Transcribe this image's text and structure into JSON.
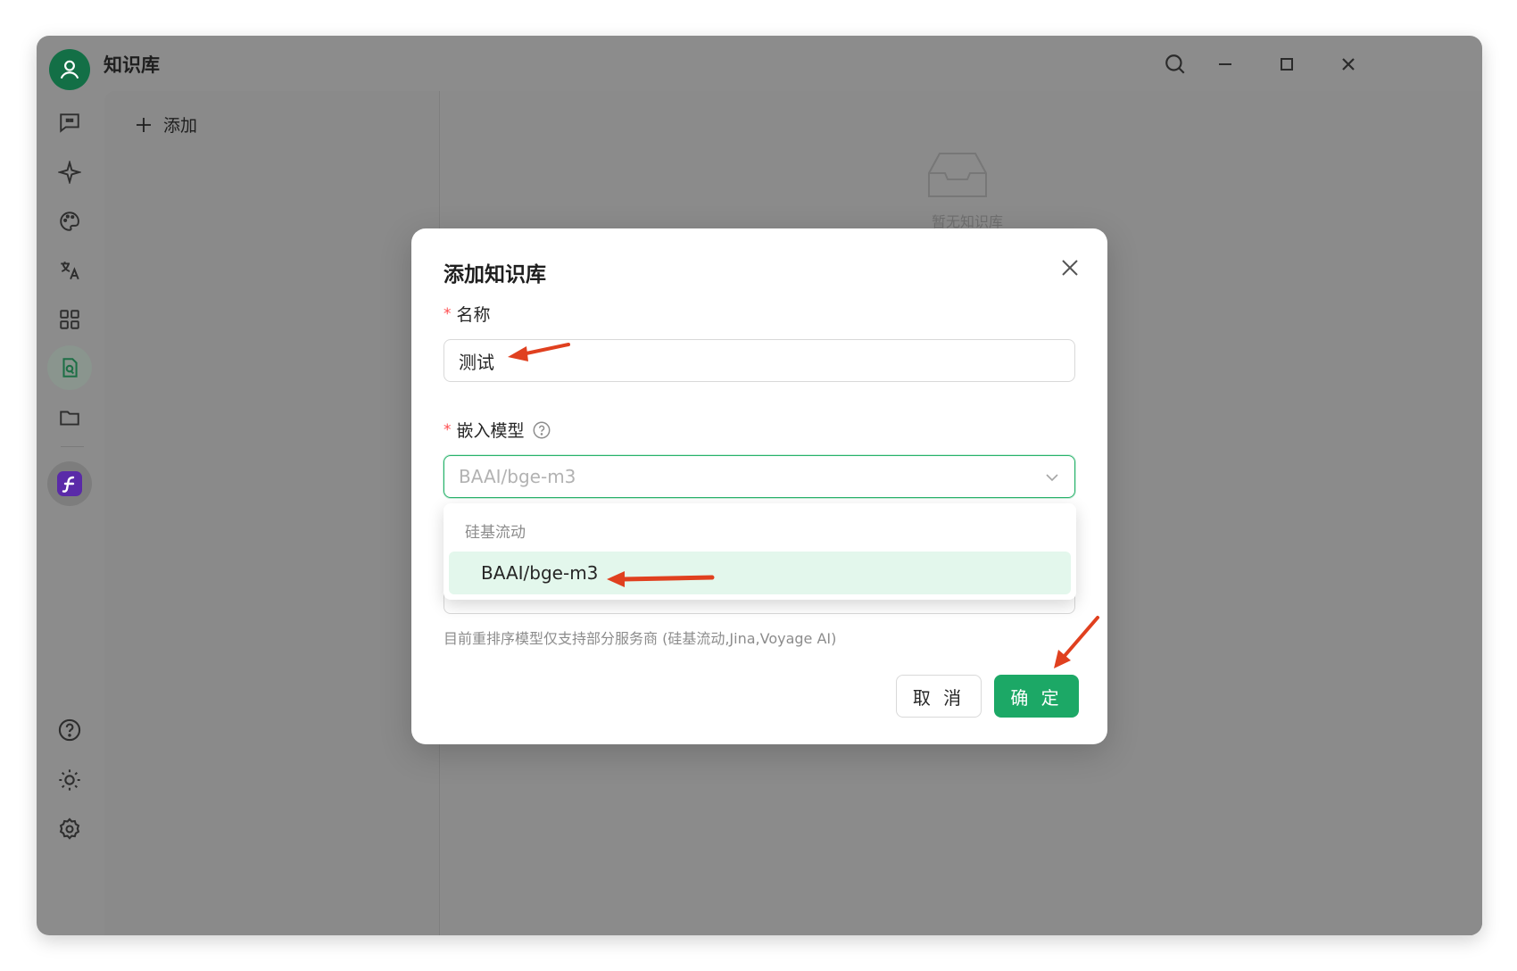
{
  "app": {
    "title": "知识库"
  },
  "kb_panel": {
    "add_label": "添加"
  },
  "main": {
    "empty_text": "暂无知识库"
  },
  "modal": {
    "title": "添加知识库",
    "name_label": "名称",
    "name_value": "测试",
    "model_label": "嵌入模型",
    "model_selected": "BAAI/bge-m3",
    "hint": "目前重排序模型仅支持部分服务商 (硅基流动,Jina,Voyage AI)",
    "cancel_label": "取 消",
    "ok_label": "确 定",
    "required_mark": "*"
  },
  "dropdown": {
    "group": "硅基流动",
    "options": [
      "BAAI/bge-m3"
    ]
  },
  "colors": {
    "accent": "#1ca866",
    "overlay": "#8c8c8c",
    "annotation_arrow": "#e0401f"
  },
  "icons": [
    "user-avatar-icon",
    "search-icon",
    "minimize-icon",
    "maximize-icon",
    "close-icon",
    "chat-icon",
    "sparkle-icon",
    "palette-icon",
    "translate-icon",
    "apps-grid-icon",
    "knowledge-base-icon",
    "folder-icon",
    "app-logo-icon",
    "help-icon",
    "theme-sun-icon",
    "settings-gear-icon",
    "plus-icon",
    "inbox-icon",
    "chevron-down-icon",
    "question-circle-icon"
  ]
}
